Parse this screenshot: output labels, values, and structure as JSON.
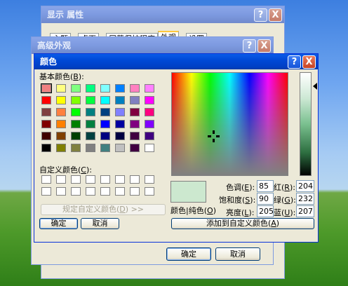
{
  "display_props": {
    "title": "显示 属性",
    "help_btn": "?",
    "close_btn": "X",
    "tabs": [
      "主题",
      "桌面",
      "屏幕保护程序",
      "外观",
      "设置"
    ]
  },
  "advanced": {
    "title": "高级外观",
    "help_btn": "?",
    "close_btn": "X",
    "ok_label": "确定",
    "cancel_label": "取消"
  },
  "color_dialog": {
    "title": "颜色",
    "help_btn": "?",
    "close_btn": "X",
    "basic_colors_label": "基本颜色",
    "basic_colors_key": "B",
    "custom_colors_label": "自定义颜色",
    "custom_colors_key": "C",
    "define_custom_label": "规定自定义颜色",
    "define_custom_key": "D",
    "define_custom_arrows": ">>",
    "ok_label": "确定",
    "cancel_label": "取消",
    "add_custom_label": "添加到自定义颜色",
    "add_custom_key": "A",
    "color_solid_label": "颜色",
    "solid_label": "纯色",
    "solid_key": "O",
    "hue_label": "色调",
    "hue_key": "E",
    "sat_label": "饱和度",
    "sat_key": "S",
    "lum_label": "亮度",
    "lum_key": "L",
    "red_label": "红",
    "red_key": "R",
    "green_label": "绿",
    "green_key": "G",
    "blue_label": "蓝",
    "blue_key": "U",
    "hue_value": "85",
    "sat_value": "90",
    "lum_value": "205",
    "red_value": "204",
    "green_value": "232",
    "blue_value": "207",
    "selected_color": "#cce8cf",
    "basic_colors": [
      [
        "#f08080",
        "#ffff80",
        "#80ff80",
        "#00ff80",
        "#80ffff",
        "#0080ff",
        "#ff80c0",
        "#ff80ff"
      ],
      [
        "#ff0000",
        "#ffff00",
        "#80ff00",
        "#00ff40",
        "#00ffff",
        "#0080c0",
        "#8080c0",
        "#ff00ff"
      ],
      [
        "#804040",
        "#ff8040",
        "#00ff00",
        "#008080",
        "#004080",
        "#8080ff",
        "#800040",
        "#ff0080"
      ],
      [
        "#800000",
        "#ff8000",
        "#008000",
        "#008040",
        "#0000ff",
        "#0000a0",
        "#800080",
        "#8000ff"
      ],
      [
        "#400000",
        "#804000",
        "#004000",
        "#004040",
        "#000080",
        "#000040",
        "#400040",
        "#400080"
      ],
      [
        "#000000",
        "#808000",
        "#808040",
        "#808080",
        "#408080",
        "#c0c0c0",
        "#400040",
        "#ffffff"
      ]
    ]
  }
}
